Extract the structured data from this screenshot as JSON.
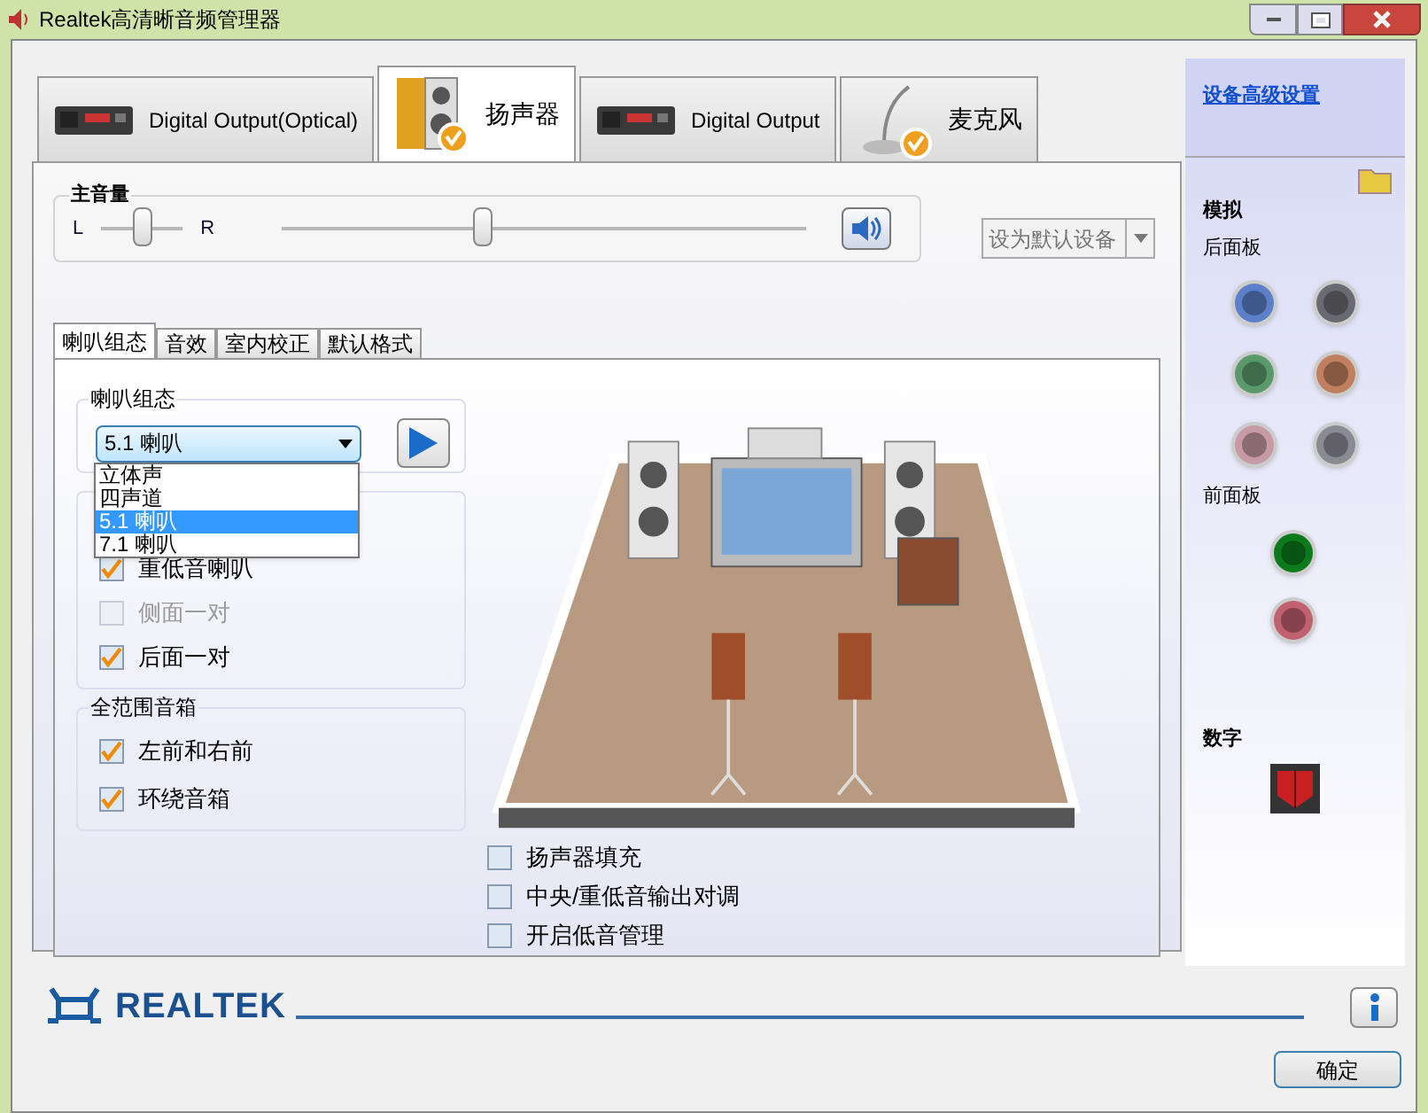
{
  "window": {
    "title": "Realtek高清晰音频管理器"
  },
  "device_tabs": [
    {
      "label": "Digital Output(Optical)",
      "selected": false,
      "kind": "digital"
    },
    {
      "label": "扬声器",
      "selected": true,
      "kind": "speaker"
    },
    {
      "label": "Digital Output",
      "selected": false,
      "kind": "digital"
    },
    {
      "label": "麦克风",
      "selected": false,
      "kind": "mic"
    }
  ],
  "master_volume": {
    "title": "主音量",
    "left_label": "L",
    "right_label": "R",
    "balance": {
      "level": 0.5
    },
    "volume": {
      "level": 0.38
    }
  },
  "default_device_button": "设为默认设备",
  "sub_tabs": [
    {
      "label": "喇叭组态",
      "selected": true
    },
    {
      "label": "音效",
      "selected": false
    },
    {
      "label": "室内校正",
      "selected": false
    },
    {
      "label": "默认格式",
      "selected": false
    }
  ],
  "speaker_config": {
    "title": "喇叭组态",
    "value": "5.1 喇叭",
    "options": [
      {
        "label": "立体声",
        "selected": false
      },
      {
        "label": "四声道",
        "selected": false
      },
      {
        "label": "5.1 喇叭",
        "selected": true
      },
      {
        "label": "7.1 喇叭",
        "selected": false
      }
    ]
  },
  "optional_speakers": [
    {
      "label": "重低音喇叭",
      "checked": true,
      "disabled": false
    },
    {
      "label": "侧面一对",
      "checked": false,
      "disabled": true
    },
    {
      "label": "后面一对",
      "checked": true,
      "disabled": false
    }
  ],
  "full_range": {
    "title": "全范围音箱",
    "items": [
      {
        "label": "左前和右前",
        "checked": true,
        "disabled": false
      },
      {
        "label": "环绕音箱",
        "checked": true,
        "disabled": false
      }
    ]
  },
  "options": [
    {
      "label": "扬声器填充",
      "checked": false,
      "disabled": false
    },
    {
      "label": "中央/重低音输出对调",
      "checked": false,
      "disabled": false
    },
    {
      "label": "开启低音管理",
      "checked": false,
      "disabled": false
    }
  ],
  "side_panel": {
    "link": "设备高级设置",
    "analog_title": "模拟",
    "rear_title": "后面板",
    "rear_jacks": [
      {
        "color": "#5b7fc8"
      },
      {
        "color": "#6a6a72"
      },
      {
        "color": "#5a9a6a"
      },
      {
        "color": "#c08060"
      },
      {
        "color": "#c89aa5"
      },
      {
        "color": "#8a8a92"
      }
    ],
    "front_title": "前面板",
    "front_jacks": [
      {
        "color": "#0a7a1a"
      },
      {
        "color": "#c06070"
      }
    ],
    "digital_title": "数字"
  },
  "footer": {
    "brand": "REALTEK",
    "ok_button": "确定"
  }
}
